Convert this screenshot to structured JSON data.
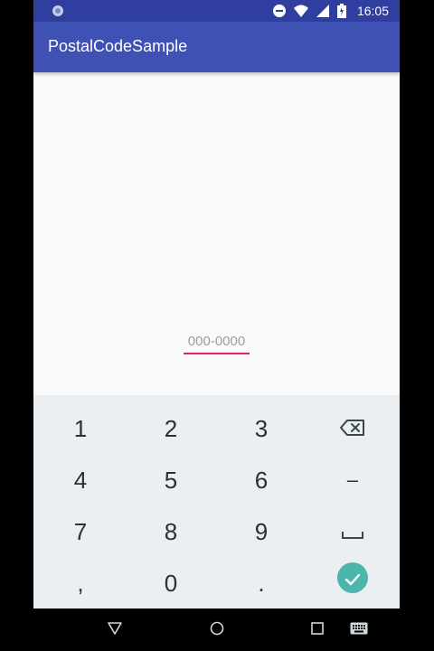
{
  "status_bar": {
    "time": "16:05",
    "icons": [
      "sync-icon",
      "do-not-disturb-icon",
      "wifi-icon",
      "signal-icon",
      "battery-icon"
    ]
  },
  "app_bar": {
    "title": "PostalCodeSample"
  },
  "postal_code": {
    "value": "",
    "placeholder": "000-0000"
  },
  "keyboard": {
    "rows": [
      [
        "1",
        "2",
        "3",
        "backspace"
      ],
      [
        "4",
        "5",
        "6",
        "–"
      ],
      [
        "7",
        "8",
        "9",
        "space"
      ],
      [
        ",",
        "0",
        ".",
        "done"
      ]
    ],
    "labels": {
      "k1": "1",
      "k2": "2",
      "k3": "3",
      "k4": "4",
      "k5": "5",
      "k6": "6",
      "dash": "–",
      "k7": "7",
      "k8": "8",
      "k9": "9",
      "comma": ",",
      "k0": "0",
      "period": "."
    },
    "accent_color": "#4db6ac"
  },
  "colors": {
    "status_bar": "#303f9f",
    "app_bar": "#3f51b5",
    "input_underline": "#e91e63",
    "keyboard_bg": "#eceff1"
  },
  "nav_bar": {
    "icons": [
      "back-icon",
      "home-icon",
      "recents-icon",
      "keyboard-icon"
    ]
  }
}
